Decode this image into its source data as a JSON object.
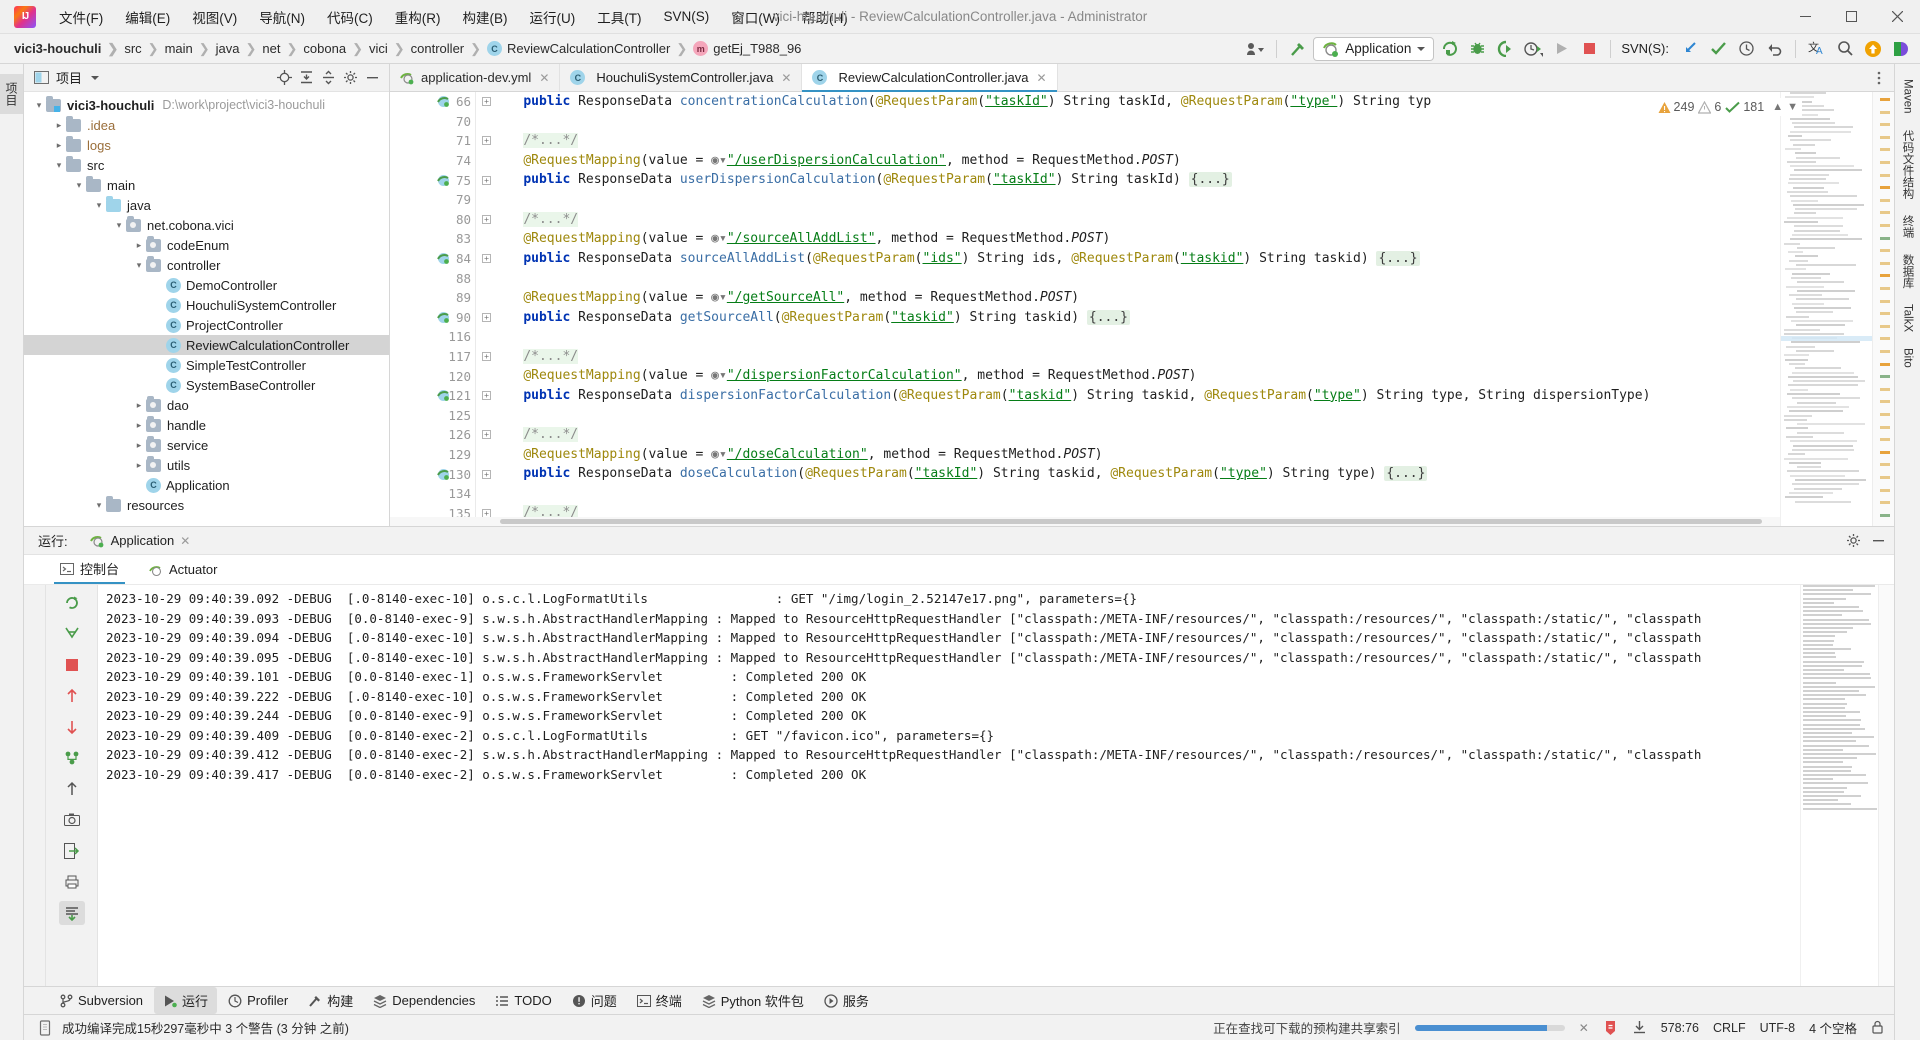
{
  "window": {
    "title": "vici-houchuli - ReviewCalculationController.java - Administrator",
    "minimize": "—",
    "maximize": "❐",
    "close": "✕"
  },
  "menubar": {
    "items": [
      {
        "label": "文件(F)"
      },
      {
        "label": "编辑(E)"
      },
      {
        "label": "视图(V)"
      },
      {
        "label": "导航(N)"
      },
      {
        "label": "代码(C)"
      },
      {
        "label": "重构(R)"
      },
      {
        "label": "构建(B)"
      },
      {
        "label": "运行(U)"
      },
      {
        "label": "工具(T)"
      },
      {
        "label": "SVN(S)"
      },
      {
        "label": "窗口(W)"
      },
      {
        "label": "帮助(H)"
      }
    ]
  },
  "navbar": {
    "breadcrumbs": [
      {
        "label": "vici3-houchuli",
        "icon": "",
        "bold": true
      },
      {
        "label": "src",
        "icon": ""
      },
      {
        "label": "main",
        "icon": ""
      },
      {
        "label": "java",
        "icon": ""
      },
      {
        "label": "net",
        "icon": ""
      },
      {
        "label": "cobona",
        "icon": ""
      },
      {
        "label": "vici",
        "icon": ""
      },
      {
        "label": "controller",
        "icon": ""
      },
      {
        "label": "ReviewCalculationController",
        "icon": "class-icon"
      },
      {
        "label": "getEj_T988_96",
        "icon": "method-icon"
      }
    ],
    "run_config": "Application",
    "svn_label": "SVN(S):",
    "icons": [
      "user-dropdown-icon",
      "build-hammer-icon",
      "rerun-icon",
      "debug-icon",
      "run-with-coverage-icon",
      "profiler-icon",
      "run-icon",
      "stop-icon",
      "svn-update-icon",
      "svn-commit-icon",
      "svn-history-icon",
      "svn-revert-icon",
      "translate-icon",
      "search-everywhere-icon",
      "update-available-icon",
      "bito-icon"
    ]
  },
  "left_stripe": {
    "tabs": [
      {
        "label": "项目",
        "selected": true
      }
    ]
  },
  "right_stripe": {
    "tabs": [
      {
        "label": "Maven"
      },
      {
        "label": "代码文件结构"
      },
      {
        "label": "终端"
      },
      {
        "label": "数据库"
      },
      {
        "label": "TalkX"
      },
      {
        "label": "Bito"
      }
    ]
  },
  "project_panel": {
    "title": "项目",
    "header_icons": [
      "locate-icon",
      "expand-all-icon",
      "collapse-all-icon",
      "settings-icon",
      "hide-icon"
    ],
    "tree": [
      {
        "depth": 0,
        "arrow": "down",
        "icon": "module-folder",
        "label": "vici3-houchuli",
        "bold": true,
        "path": "D:\\work\\project\\vici3-houchuli"
      },
      {
        "depth": 1,
        "arrow": "right",
        "icon": "folder",
        "label": ".idea",
        "excluded": true
      },
      {
        "depth": 1,
        "arrow": "right",
        "icon": "folder",
        "label": "logs",
        "excluded": true
      },
      {
        "depth": 1,
        "arrow": "down",
        "icon": "folder",
        "label": "src"
      },
      {
        "depth": 2,
        "arrow": "down",
        "icon": "folder",
        "label": "main"
      },
      {
        "depth": 3,
        "arrow": "down",
        "icon": "source-folder",
        "label": "java"
      },
      {
        "depth": 4,
        "arrow": "down",
        "icon": "package",
        "label": "net.cobona.vici"
      },
      {
        "depth": 5,
        "arrow": "right",
        "icon": "package",
        "label": "codeEnum"
      },
      {
        "depth": 5,
        "arrow": "down",
        "icon": "package",
        "label": "controller"
      },
      {
        "depth": 6,
        "arrow": "",
        "icon": "class",
        "label": "DemoController"
      },
      {
        "depth": 6,
        "arrow": "",
        "icon": "class",
        "label": "HouchuliSystemController"
      },
      {
        "depth": 6,
        "arrow": "",
        "icon": "class",
        "label": "ProjectController"
      },
      {
        "depth": 6,
        "arrow": "",
        "icon": "class",
        "label": "ReviewCalculationController",
        "selected": true
      },
      {
        "depth": 6,
        "arrow": "",
        "icon": "class",
        "label": "SimpleTestController"
      },
      {
        "depth": 6,
        "arrow": "",
        "icon": "class",
        "label": "SystemBaseController"
      },
      {
        "depth": 5,
        "arrow": "right",
        "icon": "package",
        "label": "dao"
      },
      {
        "depth": 5,
        "arrow": "right",
        "icon": "package",
        "label": "handle"
      },
      {
        "depth": 5,
        "arrow": "right",
        "icon": "package",
        "label": "service"
      },
      {
        "depth": 5,
        "arrow": "right",
        "icon": "package",
        "label": "utils"
      },
      {
        "depth": 5,
        "arrow": "",
        "icon": "class",
        "label": "Application"
      },
      {
        "depth": 3,
        "arrow": "down",
        "icon": "folder",
        "label": "resources"
      }
    ]
  },
  "editor": {
    "tabs": [
      {
        "label": "application-dev.yml",
        "icon": "yml-icon",
        "active": false
      },
      {
        "label": "HouchuliSystemController.java",
        "icon": "class-icon",
        "active": false
      },
      {
        "label": "ReviewCalculationController.java",
        "icon": "class-icon",
        "active": true
      }
    ],
    "inspection": {
      "warnings": "249",
      "weak_warnings": "6",
      "typos": "181"
    },
    "lines": [
      {
        "num": "66",
        "fold": true,
        "runmark": true,
        "html": "    <span class='kw'>public</span> ResponseData <span class='mth'>concentrationCalculation</span>(<span class='ann'>@RequestParam</span>(<span class='strU'>\"taskId\"</span>) String taskId, <span class='ann'>@RequestParam</span>(<span class='strU'>\"type\"</span>) String typ"
      },
      {
        "num": "70",
        "fold": false,
        "runmark": false,
        "html": ""
      },
      {
        "num": "71",
        "fold": true,
        "runmark": false,
        "html": "    <span class='cmt'>/*...*/</span>"
      },
      {
        "num": "74",
        "fold": false,
        "runmark": false,
        "html": "    <span class='ann'>@RequestMapping</span>(value = <span class='web'></span><span class='strU'>\"/userDispersionCalculation\"</span>, method = RequestMethod.<span class='ita'>POST</span>)"
      },
      {
        "num": "75",
        "fold": true,
        "runmark": true,
        "html": "    <span class='kw'>public</span> ResponseData <span class='mth'>userDispersionCalculation</span>(<span class='ann'>@RequestParam</span>(<span class='strU'>\"taskId\"</span>) String taskId) <span class='fldp'>{...}</span>"
      },
      {
        "num": "79",
        "fold": false,
        "runmark": false,
        "html": ""
      },
      {
        "num": "80",
        "fold": true,
        "runmark": false,
        "html": "    <span class='cmt'>/*...*/</span>"
      },
      {
        "num": "83",
        "fold": false,
        "runmark": false,
        "html": "    <span class='ann'>@RequestMapping</span>(value = <span class='web'></span><span class='strU'>\"/sourceAllAddList\"</span>, method = RequestMethod.<span class='ita'>POST</span>)"
      },
      {
        "num": "84",
        "fold": true,
        "runmark": true,
        "html": "    <span class='kw'>public</span> ResponseData <span class='mth'>sourceAllAddList</span>(<span class='ann'>@RequestParam</span>(<span class='strU'>\"ids\"</span>) String ids, <span class='ann'>@RequestParam</span>(<span class='strU'>\"taskid\"</span>) String taskid) <span class='fldp'>{...}</span>"
      },
      {
        "num": "88",
        "fold": false,
        "runmark": false,
        "html": ""
      },
      {
        "num": "89",
        "fold": false,
        "runmark": false,
        "html": "    <span class='ann'>@RequestMapping</span>(value = <span class='web'></span><span class='strU'>\"/getSourceAll\"</span>, method = RequestMethod.<span class='ita'>POST</span>)"
      },
      {
        "num": "90",
        "fold": true,
        "runmark": true,
        "html": "    <span class='kw'>public</span> ResponseData <span class='mth'>getSourceAll</span>(<span class='ann'>@RequestParam</span>(<span class='strU'>\"taskid\"</span>) String taskid) <span class='fldp'>{...}</span>"
      },
      {
        "num": "116",
        "fold": false,
        "runmark": false,
        "html": ""
      },
      {
        "num": "117",
        "fold": true,
        "runmark": false,
        "html": "    <span class='cmt'>/*...*/</span>"
      },
      {
        "num": "120",
        "fold": false,
        "runmark": false,
        "html": "    <span class='ann'>@RequestMapping</span>(value = <span class='web'></span><span class='strU'>\"/dispersionFactorCalculation\"</span>, method = RequestMethod.<span class='ita'>POST</span>)"
      },
      {
        "num": "121",
        "fold": true,
        "runmark": true,
        "html": "    <span class='kw'>public</span> ResponseData <span class='mth'>dispersionFactorCalculation</span>(<span class='ann'>@RequestParam</span>(<span class='strU'>\"taskid\"</span>) String taskid, <span class='ann'>@RequestParam</span>(<span class='strU'>\"type\"</span>) String type, String dispersionType)"
      },
      {
        "num": "125",
        "fold": false,
        "runmark": false,
        "html": ""
      },
      {
        "num": "126",
        "fold": true,
        "runmark": false,
        "html": "    <span class='cmt'>/*...*/</span>"
      },
      {
        "num": "129",
        "fold": false,
        "runmark": false,
        "html": "    <span class='ann'>@RequestMapping</span>(value = <span class='web'></span><span class='strU'>\"/doseCalculation\"</span>, method = RequestMethod.<span class='ita'>POST</span>)"
      },
      {
        "num": "130",
        "fold": true,
        "runmark": true,
        "html": "    <span class='kw'>public</span> ResponseData <span class='mth'>doseCalculation</span>(<span class='ann'>@RequestParam</span>(<span class='strU'>\"taskId\"</span>) String taskid, <span class='ann'>@RequestParam</span>(<span class='strU'>\"type\"</span>) String type) <span class='fldp'>{...}</span>"
      },
      {
        "num": "134",
        "fold": false,
        "runmark": false,
        "html": ""
      },
      {
        "num": "135",
        "fold": true,
        "runmark": false,
        "html": "    <span class='cmt'>/*...*/</span>"
      }
    ]
  },
  "run_panel": {
    "label": "运行:",
    "tab": "Application",
    "subtabs": [
      {
        "label": "控制台",
        "selected": true,
        "icon": "console-icon"
      },
      {
        "label": "Actuator",
        "selected": false,
        "icon": "actuator-icon"
      }
    ],
    "tool_icons": [
      "rerun-icon",
      "pause-icon",
      "stop-icon",
      "up-icon",
      "down-icon",
      "thread-dump-icon",
      "camera-icon",
      "export-icon",
      "print-icon",
      "scroll-end-icon"
    ],
    "header_icons": [
      "settings-icon",
      "hide-icon"
    ],
    "console_lines": [
      "2023-10-29 09:40:39.092 -DEBUG  [.0-8140-exec-10] o.s.c.l.LogFormatUtils                 : GET \"/img/login_2.52147e17.png\", parameters={}",
      "2023-10-29 09:40:39.093 -DEBUG  [0.0-8140-exec-9] s.w.s.h.AbstractHandlerMapping : Mapped to ResourceHttpRequestHandler [\"classpath:/META-INF/resources/\", \"classpath:/resources/\", \"classpath:/static/\", \"classpath",
      "2023-10-29 09:40:39.094 -DEBUG  [.0-8140-exec-10] s.w.s.h.AbstractHandlerMapping : Mapped to ResourceHttpRequestHandler [\"classpath:/META-INF/resources/\", \"classpath:/resources/\", \"classpath:/static/\", \"classpath",
      "2023-10-29 09:40:39.095 -DEBUG  [.0-8140-exec-10] s.w.s.h.AbstractHandlerMapping : Mapped to ResourceHttpRequestHandler [\"classpath:/META-INF/resources/\", \"classpath:/resources/\", \"classpath:/static/\", \"classpath",
      "2023-10-29 09:40:39.101 -DEBUG  [0.0-8140-exec-1] o.s.w.s.FrameworkServlet         : Completed 200 OK",
      "2023-10-29 09:40:39.222 -DEBUG  [.0-8140-exec-10] o.s.w.s.FrameworkServlet         : Completed 200 OK",
      "2023-10-29 09:40:39.244 -DEBUG  [0.0-8140-exec-9] o.s.w.s.FrameworkServlet         : Completed 200 OK",
      "2023-10-29 09:40:39.409 -DEBUG  [0.0-8140-exec-2] o.s.c.l.LogFormatUtils           : GET \"/favicon.ico\", parameters={}",
      "2023-10-29 09:40:39.412 -DEBUG  [0.0-8140-exec-2] s.w.s.h.AbstractHandlerMapping : Mapped to ResourceHttpRequestHandler [\"classpath:/META-INF/resources/\", \"classpath:/resources/\", \"classpath:/static/\", \"classpath",
      "2023-10-29 09:40:39.417 -DEBUG  [0.0-8140-exec-2] o.s.w.s.FrameworkServlet         : Completed 200 OK"
    ]
  },
  "bottom_toolbar": {
    "items": [
      {
        "label": "Subversion",
        "icon": "branch-icon",
        "selected": false
      },
      {
        "label": "运行",
        "icon": "run-icon",
        "selected": true
      },
      {
        "label": "Profiler",
        "icon": "profiler-icon",
        "selected": false
      },
      {
        "label": "构建",
        "icon": "build-icon",
        "selected": false
      },
      {
        "label": "Dependencies",
        "icon": "dependencies-icon",
        "selected": false
      },
      {
        "label": "TODO",
        "icon": "todo-icon",
        "selected": false
      },
      {
        "label": "问题",
        "icon": "problems-icon",
        "selected": false
      },
      {
        "label": "终端",
        "icon": "terminal-icon",
        "selected": false
      },
      {
        "label": "Python 软件包",
        "icon": "python-packages-icon",
        "selected": false
      },
      {
        "label": "服务",
        "icon": "services-icon",
        "selected": false
      }
    ]
  },
  "status_bar": {
    "message": "成功编译完成15秒297毫秒中 3 个警告 (3 分钟 之前)",
    "indexing": "正在查找可下载的预构建共享索引",
    "position": "578:76",
    "line_sep": "CRLF",
    "encoding": "UTF-8",
    "indent": "4 个空格",
    "icons": [
      "memory-icon",
      "close-progress-icon",
      "inspection-icon",
      "download-icon",
      "lock-icon"
    ],
    "colors": {
      "accent": "#3592c4",
      "progress": "#4a8fd1",
      "warn": "#e8a33d",
      "error": "#e05252"
    }
  }
}
